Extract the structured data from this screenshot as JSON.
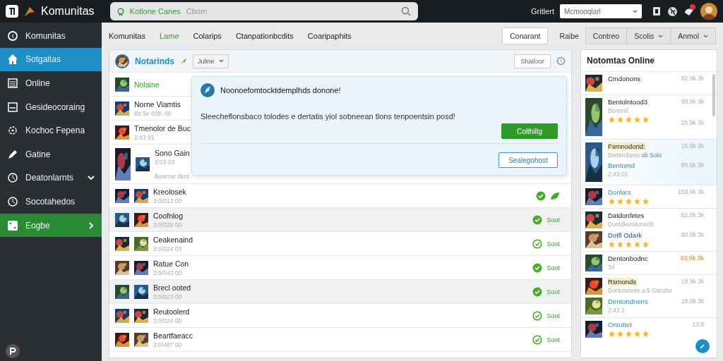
{
  "topbar": {
    "brand": "Komunitas",
    "search": {
      "scope": "Kotlone Canes",
      "placeholder": "Cbom"
    },
    "filter_label": "Gritlert",
    "filter_select": "Mcmooqlarl"
  },
  "sidebar": {
    "items": [
      {
        "label": "Komunitas",
        "selected": false
      },
      {
        "label": "Sotgaltas",
        "selected": true,
        "color": "#1e8fc4"
      },
      {
        "label": "Online",
        "selected": false
      },
      {
        "label": "Gesideocoraing",
        "selected": false
      },
      {
        "label": "Kochoc Fepena",
        "selected": false
      },
      {
        "label": "Gatine",
        "selected": false
      },
      {
        "label": "Deatonlarnts",
        "selected": false,
        "expanded": true
      },
      {
        "label": "Socotahedos",
        "selected": false
      },
      {
        "label": "Eogbe",
        "selected": true,
        "color": "#2b8a34",
        "expanded": false
      }
    ]
  },
  "nav": {
    "tabs": [
      {
        "label": "Komunitas",
        "selected": false
      },
      {
        "label": "Lame",
        "selected": true
      },
      {
        "label": "Colarips",
        "selected": false
      },
      {
        "label": "Ctanpationbcdits",
        "selected": false
      },
      {
        "label": "Coaripaphits",
        "selected": false
      }
    ],
    "buttons": [
      {
        "label": "Conarant",
        "kind": "outline"
      },
      {
        "label": "Raibe",
        "kind": "plain"
      },
      {
        "label": "Contreo",
        "kind": "segment"
      },
      {
        "label": "Scolis",
        "kind": "menu"
      },
      {
        "label": "Anmol",
        "kind": "menu"
      }
    ]
  },
  "main": {
    "title": "Notarinds",
    "select": "Juline",
    "action": "Shatloor",
    "list": [
      {
        "kind": "accent",
        "title": "Nolaine"
      },
      {
        "kind": "plain",
        "title": "Norne Viamtis",
        "subtitle": "Bs 5e 039, 06"
      },
      {
        "kind": "plain",
        "title": "Tmenolor de Buc",
        "subtitle": "2:43 01"
      },
      {
        "kind": "plain",
        "title": "Sono Gain",
        "subtitle": "3:03 03",
        "note": "Bearnar dent"
      }
    ],
    "rows": [
      {
        "title": "Kreolosek",
        "subtitle": "3:0/013 00",
        "checked": true,
        "kind": "leaf",
        "selected": false
      },
      {
        "title": "Coofnlog",
        "subtitle": "3:0/028 00",
        "checked": true,
        "kind": "label",
        "label": "Soot",
        "selected": true
      },
      {
        "title": "Ceakenaind",
        "subtitle": "3:0/024 03",
        "checked": false,
        "kind": "label",
        "label": "Soot",
        "selected": false
      },
      {
        "title": "Ratue Con",
        "subtitle": "3:0/043 00",
        "checked": true,
        "kind": "label",
        "label": "Soot",
        "selected": false
      },
      {
        "title": "Brecl ooted",
        "subtitle": "3:0/023 00",
        "checked": true,
        "kind": "label",
        "label": "Soot",
        "selected": true
      },
      {
        "title": "Reutoolerd",
        "subtitle": "3:0/024 00",
        "checked": false,
        "kind": "label",
        "label": "Soot",
        "selected": false
      },
      {
        "title": "Beartfaeacc",
        "subtitle": "3:0/487 00",
        "checked": false,
        "kind": "label",
        "label": "Soot",
        "selected": false
      }
    ],
    "dialog": {
      "title": "Noonoefomtocktdemplhds donone!",
      "body": "Sleecheflonsbaco tolodes e dertatis yiol sobneean tlons tenpoentsin posd!",
      "primary": "Colthiltg",
      "secondary": "Sealegohost"
    }
  },
  "online": {
    "title": "Notomtas Online",
    "groups": [
      {
        "selected": false,
        "entries": [
          {
            "title": "Cmdonons",
            "kind": "plain",
            "times": [
              "82.9k 3k"
            ]
          }
        ]
      },
      {
        "selected": false,
        "entries": [
          {
            "title": "Bentolntood3",
            "kind": "plain",
            "subtitle": "Bennnil",
            "stars": 5,
            "times": [
              "80.9k 3k",
              "26.9k 3k"
            ]
          }
        ]
      },
      {
        "selected": true,
        "entries": [
          {
            "title": "Fsmnodorid:",
            "kind": "highlight",
            "subtitle": "Bsmnobeso",
            "link": "ob Soio",
            "times": [
              "15.9k 3k"
            ]
          },
          {
            "title": "Bentomd",
            "kind": "link",
            "subtitle": "2:43 01",
            "times": [
              "80.6k 3k"
            ]
          }
        ]
      },
      {
        "selected": false,
        "entries": [
          {
            "title": "Dorilars",
            "kind": "link",
            "stars": 5,
            "times": [
              "159.9k 3k"
            ]
          }
        ]
      },
      {
        "selected": false,
        "entries": [
          {
            "title": "Datdonfetes",
            "kind": "plain",
            "subtitle": "Dontdkeratoneds",
            "times": [
              "82.8k 3k"
            ]
          },
          {
            "title": "Dotfl Odark",
            "kind": "navy",
            "stars": 5,
            "times": [
              "80.6k 3k"
            ]
          }
        ]
      },
      {
        "selected": false,
        "entries": [
          {
            "title": "Dentonbodnc",
            "kind": "plain",
            "subtitle": "34",
            "times": [
              "03.0k 3k"
            ],
            "color": "#e8a040"
          }
        ]
      },
      {
        "selected": false,
        "entries": [
          {
            "title": "Rsmonds",
            "kind": "highlight",
            "subtitle": "Dontoseese a.5 Gscube",
            "times": [
              "18.9k 3k"
            ]
          },
          {
            "title": "Dentondnens",
            "kind": "link",
            "subtitle": "2:43 2",
            "times": [
              "18.9k 3k"
            ]
          }
        ]
      },
      {
        "selected": false,
        "entries": [
          {
            "title": "Ontottet",
            "kind": "link",
            "stars": 5,
            "times": [
              "13:9"
            ]
          }
        ]
      }
    ]
  }
}
